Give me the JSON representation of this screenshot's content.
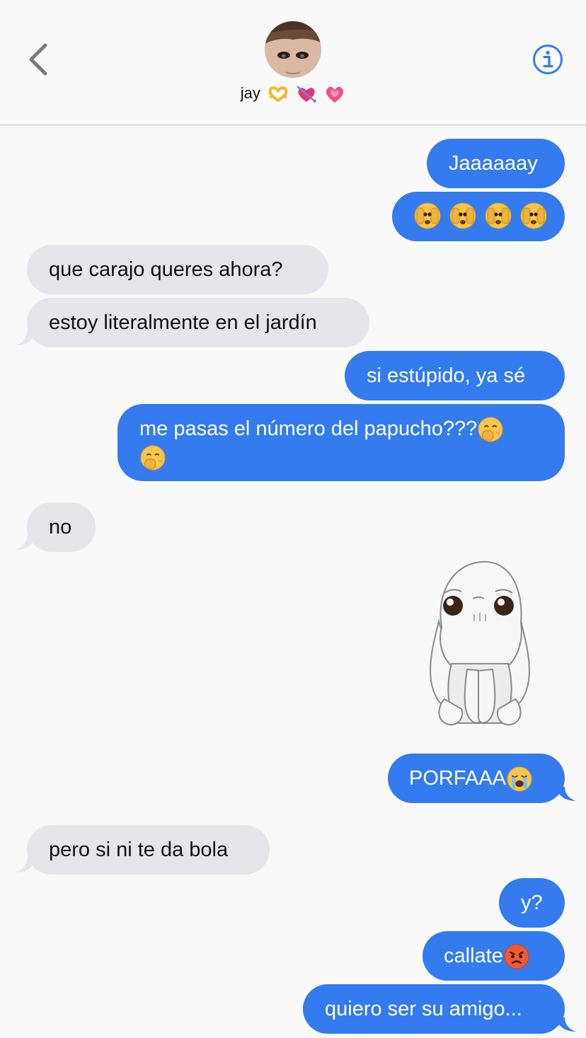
{
  "header": {
    "contact_name": "jay",
    "name_emojis": [
      "heart-hands-emoji",
      "heart-with-arrow-emoji",
      "growing-heart-emoji"
    ],
    "back_icon": "chevron-left-icon",
    "info_icon": "info-icon",
    "accent_color": "#347bf0"
  },
  "messages": [
    {
      "side": "out",
      "text": "Jaaaaaay"
    },
    {
      "side": "out",
      "text": "",
      "emojis": [
        "face-with-peeking-eye",
        "face-with-peeking-eye",
        "face-with-peeking-eye",
        "face-with-peeking-eye"
      ]
    },
    {
      "side": "in",
      "text": "que carajo queres ahora?"
    },
    {
      "side": "in",
      "text": "estoy literalmente en el jardín"
    },
    {
      "side": "out",
      "text": "si estúpido, ya sé"
    },
    {
      "side": "out",
      "text": "me pasas el número del papucho???",
      "emojis": [
        "face-with-hand-over-mouth",
        "face-with-hand-over-mouth"
      ]
    },
    {
      "side": "in",
      "text": "no"
    },
    {
      "side": "out",
      "sticker": "white-fluffy-creature-sticker"
    },
    {
      "side": "out",
      "text": "PORFAAA",
      "emojis": [
        "loudly-crying-face"
      ]
    },
    {
      "side": "in",
      "text": "pero si ni te da bola"
    },
    {
      "side": "out",
      "text": "y?"
    },
    {
      "side": "out",
      "text": "callate",
      "emojis": [
        "angry-face"
      ]
    },
    {
      "side": "out",
      "text": "quiero ser su amigo..."
    }
  ],
  "colors": {
    "incoming_bubble": "#e5e5ea",
    "outgoing_bubble": "#347bf0",
    "background": "#f9f9f9"
  }
}
